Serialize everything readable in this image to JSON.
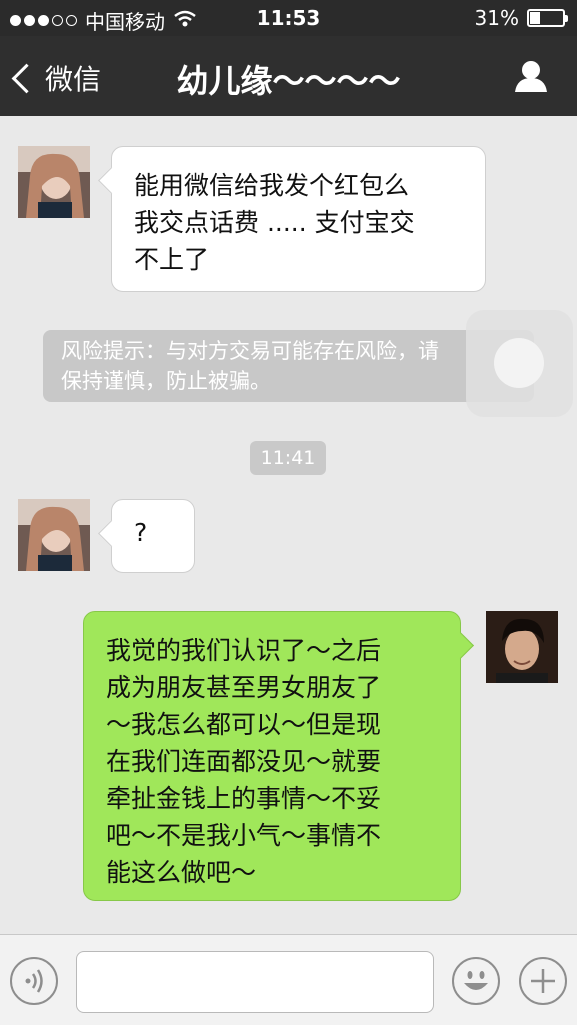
{
  "status": {
    "carrier": "中国移动",
    "time": "11:53",
    "battery_text": "31%",
    "battery_level": 0.31
  },
  "nav": {
    "back_label": "微信",
    "title": "幼儿缘～～～～"
  },
  "messages": [
    {
      "side": "left",
      "text": "能用微信给我发个红包么\n我交点话费 ..... 支付宝交\n不上了"
    },
    {
      "side": "left",
      "text": "?"
    },
    {
      "side": "right",
      "text": "我觉的我们认识了～之后\n成为朋友甚至男女朋友了\n～我怎么都可以～但是现\n在我们连面都没见～就要\n牵扯金钱上的事情～不妥\n吧～不是我小气～事情不\n能这么做吧～"
    }
  ],
  "risk_notice": "风险提示：与对方交易可能存在风险，请\n保持谨慎，防止被骗。",
  "time_divider": "11:41",
  "input": {
    "value": "",
    "placeholder": ""
  },
  "colors": {
    "nav_bg": "#2f2f2f",
    "chat_bg": "#e9e9e9",
    "bubble_right": "#a0e75a"
  },
  "icons": [
    "signal-dots-icon",
    "wifi-icon",
    "battery-icon",
    "back-chevron-icon",
    "profile-icon",
    "voice-icon",
    "emoji-icon",
    "plus-icon"
  ]
}
